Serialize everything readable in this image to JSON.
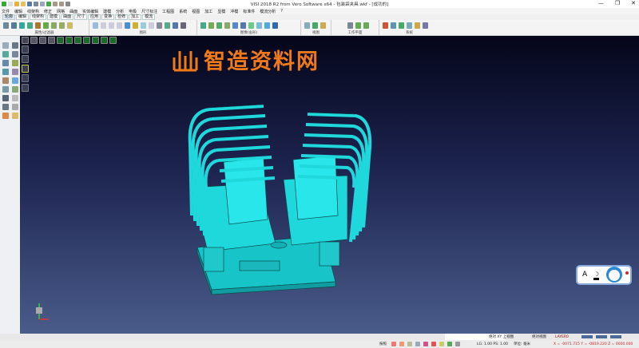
{
  "title": "VISI 2018 R2 from Vero Software x64 - 包装袋夹具.wkf - [成功的]",
  "window_controls": {
    "minimize": "—",
    "maximize": "❐",
    "close": "✕"
  },
  "menu": [
    "文件",
    "编辑",
    "线架构",
    "修正",
    "网格",
    "曲面",
    "实体编辑",
    "建模",
    "分析",
    "电极",
    "尺寸标注",
    "工程图",
    "系统",
    "视图",
    "加工",
    "显模",
    "冲模",
    "标准件",
    "模流分析",
    "?"
  ],
  "tabs": [
    {
      "label": "轮廓",
      "active": true
    },
    {
      "label": "编辑"
    },
    {
      "label": "线架构"
    },
    {
      "label": "建模"
    },
    {
      "label": "曲面"
    },
    {
      "label": "尺寸"
    },
    {
      "label": "应用"
    },
    {
      "label": "变换"
    },
    {
      "label": "检修"
    },
    {
      "label": "加工"
    },
    {
      "label": "模流"
    }
  ],
  "ribbon_groups": [
    "属性/过滤器",
    "图形",
    "图像(舍形)",
    "视图",
    "工作平面",
    "系统"
  ],
  "watermark": "智造资料网",
  "status": {
    "view_mode": "绝对 XY 上视图",
    "view_name": "绝对视图",
    "layer": "LAYER0",
    "prompt": "按照",
    "scale": "LG: 1.00 PS: 1.00",
    "units": "单位: 毫米",
    "coords": "X = -0071.715 Y = -0819.220 Z = 0000.000"
  },
  "colors": {
    "model": "#1fd8dc",
    "accent_logo": "#f07a1a",
    "coords": "#d02020"
  }
}
